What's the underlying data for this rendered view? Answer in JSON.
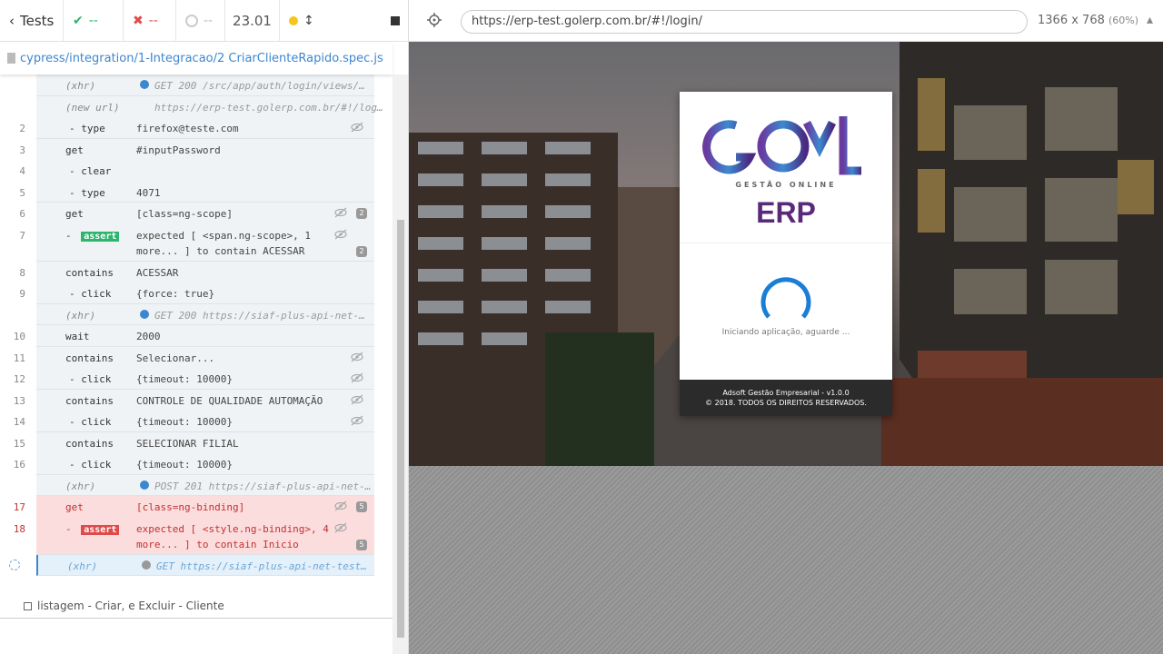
{
  "reporter": {
    "tests_label": "Tests",
    "passed": "--",
    "failed": "--",
    "pending": "--",
    "duration": "23.01",
    "spec_path": "cypress/integration/1-Integracao/2 CriarClienteRapido.spec.js",
    "next_test": "listagem - Criar, e Excluir - Cliente"
  },
  "commands": [
    {
      "num": "",
      "name": "(xhr)",
      "msg": "GET 200 /src/app/auth/login/views/…",
      "type": "xhr"
    },
    {
      "num": "",
      "name": "(new url)",
      "msg": "https://erp-test.golerp.com.br/#!/log…",
      "type": "newurl"
    },
    {
      "num": "2",
      "name": "- type",
      "msg": "firefox@teste.com",
      "type": "child",
      "eye": true
    },
    {
      "num": "3",
      "name": "get",
      "msg": "#inputPassword",
      "type": "parent"
    },
    {
      "num": "4",
      "name": "- clear",
      "msg": "",
      "type": "child"
    },
    {
      "num": "5",
      "name": "- type",
      "msg": "4071",
      "type": "child"
    },
    {
      "num": "6",
      "name": "get",
      "msg": "[class=ng-scope]",
      "type": "parent",
      "eye": true,
      "badge": "2"
    },
    {
      "num": "7",
      "name": "assert",
      "msg": "expected [ <span.ng-scope>, 1 more... ] to contain ACESSAR",
      "type": "assert",
      "eye": true,
      "badge": "2"
    },
    {
      "num": "8",
      "name": "contains",
      "msg": "ACESSAR",
      "type": "parent"
    },
    {
      "num": "9",
      "name": "- click",
      "msg": "{force: true}",
      "type": "child"
    },
    {
      "num": "",
      "name": "(xhr)",
      "msg": "GET 200 https://siaf-plus-api-net-…",
      "type": "xhr"
    },
    {
      "num": "10",
      "name": "wait",
      "msg": "2000",
      "type": "parent"
    },
    {
      "num": "11",
      "name": "contains",
      "msg": "Selecionar...",
      "type": "parent",
      "eye": true
    },
    {
      "num": "12",
      "name": "- click",
      "msg": "{timeout: 10000}",
      "type": "child",
      "eye": true
    },
    {
      "num": "13",
      "name": "contains",
      "msg": "CONTROLE DE QUALIDADE AUTOMAÇÃO",
      "type": "parent",
      "eye": true
    },
    {
      "num": "14",
      "name": "- click",
      "msg": "{timeout: 10000}",
      "type": "child",
      "eye": true
    },
    {
      "num": "15",
      "name": "contains",
      "msg": "SELECIONAR FILIAL",
      "type": "parent"
    },
    {
      "num": "16",
      "name": "- click",
      "msg": "{timeout: 10000}",
      "type": "child"
    },
    {
      "num": "",
      "name": "(xhr)",
      "msg": "POST 201 https://siaf-plus-api-net-…",
      "type": "xhr"
    },
    {
      "num": "17",
      "name": "get",
      "msg": "[class=ng-binding]",
      "type": "fail",
      "eye": true,
      "badge": "5"
    },
    {
      "num": "18",
      "name": "assert",
      "msg": "expected [ <style.ng-binding>, 4 more... ] to contain Inicio",
      "type": "failassert",
      "eye": true,
      "badge": "5"
    },
    {
      "num": "",
      "name": "(xhr)",
      "msg": "GET https://siaf-plus-api-net-test…",
      "type": "pending"
    }
  ],
  "aut": {
    "url": "https://erp-test.golerp.com.br/#!/login/",
    "viewport": "1366 x 768",
    "scale": "(60%)"
  },
  "login": {
    "tagline": "GESTÃO ONLINE",
    "title": "ERP",
    "loading": "Iniciando aplicação, aguarde ...",
    "footer_line1": "Adsoft Gestão Empresarial - v1.0.0",
    "footer_line2": "© 2018. TODOS OS DIREITOS RESERVADOS."
  },
  "colors": {
    "pass": "#2db56d",
    "fail": "#e04a4a",
    "accent": "#3c87d0",
    "erp": "#5a2a7a"
  }
}
